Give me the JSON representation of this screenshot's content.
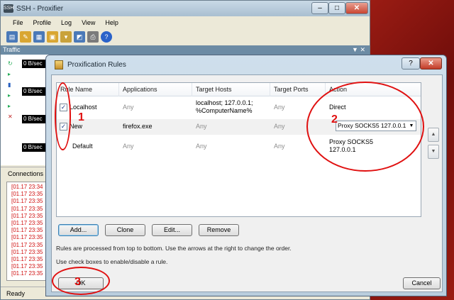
{
  "main_window": {
    "title": "SSH - Proxifier",
    "title_icon": "SSH",
    "menu": [
      "File",
      "Profile",
      "Log",
      "View",
      "Help"
    ],
    "toolbar_icons": [
      "profile-icon",
      "new-profile-icon",
      "open-icon",
      "save-icon",
      "import-icon",
      "export-icon",
      "print-icon",
      "help-icon"
    ],
    "traffic_label": "Traffic",
    "panel_controls": "▼ ✕",
    "speeds": [
      "0 B/sec",
      "0 B/sec",
      "0 B/sec",
      "0 B/sec"
    ],
    "connections_label": "Connections",
    "log_lines": [
      "[01.17 23:34",
      "[01.17 23:35",
      "[01.17 23:35",
      "[01.17 23:35",
      "[01.17 23:35",
      "[01.17 23:35",
      "[01.17 23:35",
      "[01.17 23:35",
      "[01.17 23:35",
      "[01.17 23:35",
      "[01.17 23:35",
      "[01.17 23:35",
      "[01.17 23:35"
    ],
    "status": "Ready"
  },
  "dialog": {
    "title": "Proxification Rules",
    "help_label": "?",
    "close_label": "✕",
    "columns": [
      "Rule Name",
      "Applications",
      "Target Hosts",
      "Target Ports",
      "Action"
    ],
    "rules": [
      {
        "name": "Localhost",
        "applications": "Any",
        "hosts_line1": "localhost; 127.0.0.1;",
        "hosts_line2": "%ComputerName%",
        "ports": "Any",
        "action": "Direct",
        "checked": "✓"
      },
      {
        "name": "New",
        "applications": "firefox.exe",
        "hosts": "Any",
        "ports": "Any",
        "action": "Proxy SOCKS5 127.0.0.1",
        "checked": "✓"
      },
      {
        "name": "Default",
        "applications": "Any",
        "hosts": "Any",
        "ports": "Any",
        "action_line1": "Proxy SOCKS5",
        "action_line2": "127.0.0.1"
      }
    ],
    "move_up": "▲",
    "move_down": "▼",
    "buttons": {
      "add": "Add...",
      "clone": "Clone",
      "edit": "Edit...",
      "remove": "Remove",
      "ok": "OK",
      "cancel": "Cancel"
    },
    "info_line1": "Rules are processed from top to bottom. Use the arrows at the right to change the order.",
    "info_line2": "Use check boxes to enable/disable a rule."
  },
  "annotations": {
    "one": "1",
    "two": "2",
    "three": "3",
    "color": "#e01010"
  }
}
